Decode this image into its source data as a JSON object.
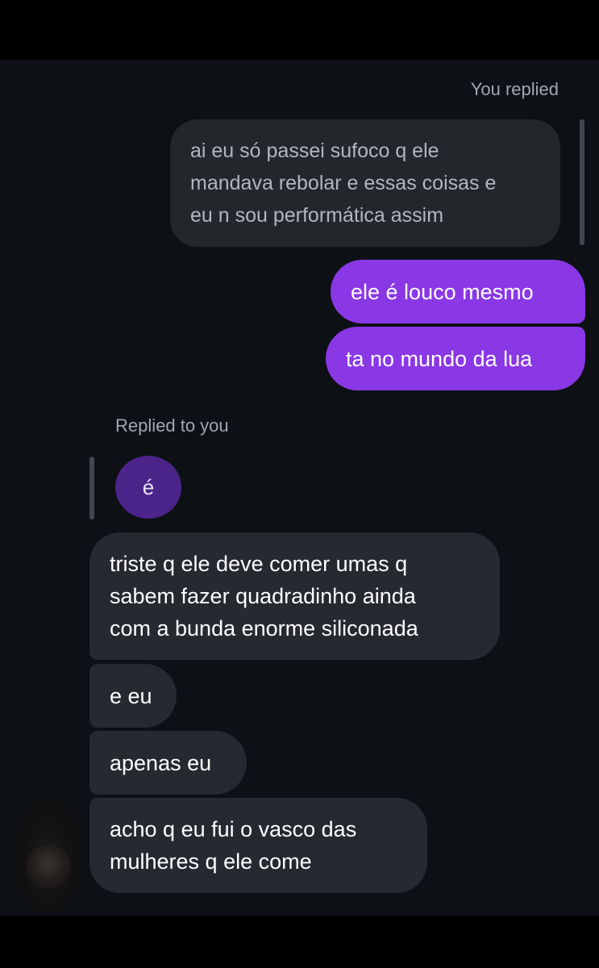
{
  "conversation": {
    "reply_label_outgoing": "You replied",
    "quoted_outgoing": "ai eu só passei sufoco q ele\nmandava rebolar e essas coisas e\neu n sou performática assim",
    "sent_messages": [
      "ele é louco mesmo",
      "ta no mundo da lua"
    ],
    "reply_label_incoming": "Replied to you",
    "quoted_incoming": "é",
    "received_messages": [
      "triste q ele deve comer umas q\nsabem fazer quadradinho ainda\ncom a bunda enorme siliconada",
      "e eu",
      "apenas eu",
      "acho q eu fui o vasco das\nmulheres q ele come"
    ]
  },
  "colors": {
    "background": "#0d1015",
    "sent_bubble": "#8a37e6",
    "received_bubble": "#262a30",
    "quoted_bubble_outgoing": "#23262b",
    "quoted_bubble_incoming": "#4b2489",
    "label_text": "#a3a6ad"
  },
  "icons": {
    "avatar": "contact-avatar"
  }
}
